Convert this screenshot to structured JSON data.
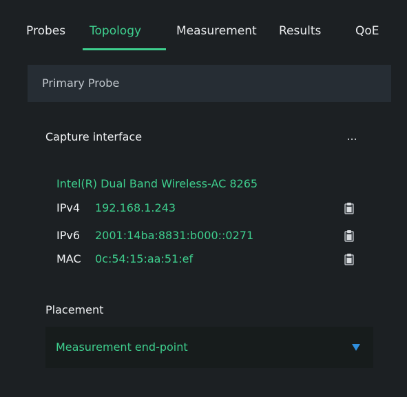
{
  "tabs": [
    {
      "label": "Probes",
      "active": false
    },
    {
      "label": "Topology",
      "active": true
    },
    {
      "label": "Measurement",
      "active": false
    },
    {
      "label": "Results",
      "active": false
    },
    {
      "label": "QoE",
      "active": false
    }
  ],
  "section": {
    "title": "Primary Probe"
  },
  "capture": {
    "label": "Capture interface",
    "more_label": "...",
    "interface_name": "Intel(R) Dual Band Wireless-AC 8265",
    "addresses": [
      {
        "key": "IPv4",
        "value": "192.168.1.243",
        "icon": "clipboard-icon"
      },
      {
        "key": "IPv6",
        "value": "2001:14ba:8831:b000::0271",
        "icon": "clipboard-icon"
      },
      {
        "key": "MAC",
        "value": "0c:54:15:aa:51:ef",
        "icon": "clipboard-icon"
      }
    ]
  },
  "placement": {
    "label": "Placement",
    "selected": "Measurement end-point",
    "icon": "triangle-down-icon"
  },
  "colors": {
    "background": "#1c2023",
    "accent": "#3ecf8e",
    "dropdown_arrow": "#2f8fde",
    "header_bar": "#262d34",
    "select_bg": "#171c1c"
  }
}
